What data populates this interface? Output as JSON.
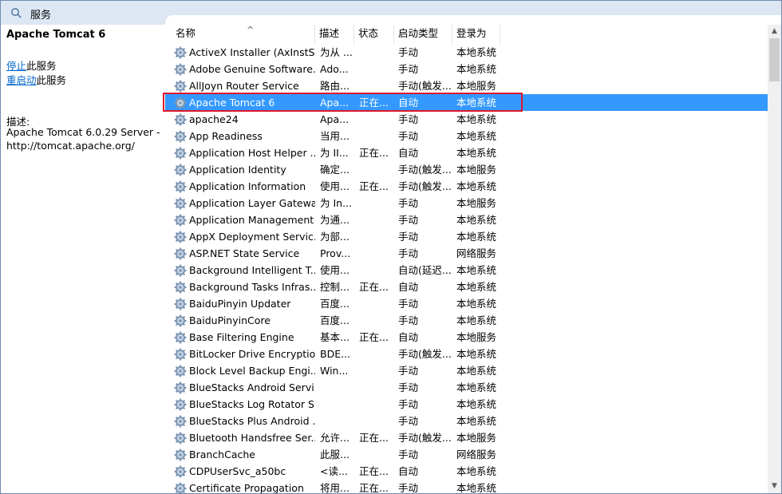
{
  "window": {
    "title": "服务",
    "icon": "services-search-icon"
  },
  "left_panel": {
    "service_name": "Apache Tomcat 6",
    "actions": [
      {
        "link": "停止",
        "suffix": "此服务"
      },
      {
        "link": "重启动",
        "suffix": "此服务"
      }
    ],
    "description_label": "描述:",
    "description_text": "Apache Tomcat 6.0.29 Server - http://tomcat.apache.org/"
  },
  "table": {
    "columns": [
      "名称",
      "描述",
      "状态",
      "启动类型",
      "登录为"
    ],
    "sort_indicator": "^",
    "selected_index": 3,
    "rows": [
      {
        "name": "ActiveX Installer (AxInstSV)",
        "desc": "为从 ...",
        "status": "",
        "startup": "手动",
        "logon": "本地系统"
      },
      {
        "name": "Adobe Genuine Software...",
        "desc": "Ado...",
        "status": "",
        "startup": "手动",
        "logon": "本地系统"
      },
      {
        "name": "AllJoyn Router Service",
        "desc": "路由...",
        "status": "",
        "startup": "手动(触发...",
        "logon": "本地服务"
      },
      {
        "name": "Apache Tomcat 6",
        "desc": "Apa...",
        "status": "正在...",
        "startup": "自动",
        "logon": "本地系统"
      },
      {
        "name": "apache24",
        "desc": "Apa...",
        "status": "",
        "startup": "手动",
        "logon": "本地系统"
      },
      {
        "name": "App Readiness",
        "desc": "当用...",
        "status": "",
        "startup": "手动",
        "logon": "本地系统"
      },
      {
        "name": "Application Host Helper ...",
        "desc": "为 II...",
        "status": "正在...",
        "startup": "自动",
        "logon": "本地系统"
      },
      {
        "name": "Application Identity",
        "desc": "确定...",
        "status": "",
        "startup": "手动(触发...",
        "logon": "本地服务"
      },
      {
        "name": "Application Information",
        "desc": "使用...",
        "status": "正在...",
        "startup": "手动(触发...",
        "logon": "本地系统"
      },
      {
        "name": "Application Layer Gatewa...",
        "desc": "为 In...",
        "status": "",
        "startup": "手动",
        "logon": "本地服务"
      },
      {
        "name": "Application Management",
        "desc": "为通...",
        "status": "",
        "startup": "手动",
        "logon": "本地系统"
      },
      {
        "name": "AppX Deployment Servic...",
        "desc": "为部...",
        "status": "",
        "startup": "手动",
        "logon": "本地系统"
      },
      {
        "name": "ASP.NET State Service",
        "desc": "Prov...",
        "status": "",
        "startup": "手动",
        "logon": "网络服务"
      },
      {
        "name": "Background Intelligent T...",
        "desc": "使用...",
        "status": "",
        "startup": "自动(延迟...",
        "logon": "本地系统"
      },
      {
        "name": "Background Tasks Infras...",
        "desc": "控制...",
        "status": "正在...",
        "startup": "自动",
        "logon": "本地系统"
      },
      {
        "name": "BaiduPinyin Updater",
        "desc": "百度...",
        "status": "",
        "startup": "手动",
        "logon": "本地系统"
      },
      {
        "name": "BaiduPinyinCore",
        "desc": "百度...",
        "status": "",
        "startup": "手动",
        "logon": "本地系统"
      },
      {
        "name": "Base Filtering Engine",
        "desc": "基本...",
        "status": "正在...",
        "startup": "自动",
        "logon": "本地服务"
      },
      {
        "name": "BitLocker Drive Encryptio...",
        "desc": "BDE...",
        "status": "",
        "startup": "手动(触发...",
        "logon": "本地系统"
      },
      {
        "name": "Block Level Backup Engi...",
        "desc": "Win...",
        "status": "",
        "startup": "手动",
        "logon": "本地系统"
      },
      {
        "name": "BlueStacks Android Servi...",
        "desc": "",
        "status": "",
        "startup": "手动",
        "logon": "本地系统"
      },
      {
        "name": "BlueStacks Log Rotator S...",
        "desc": "",
        "status": "",
        "startup": "手动",
        "logon": "本地系统"
      },
      {
        "name": "BlueStacks Plus Android ...",
        "desc": "",
        "status": "",
        "startup": "手动",
        "logon": "本地系统"
      },
      {
        "name": "Bluetooth Handsfree Ser...",
        "desc": "允许...",
        "status": "正在...",
        "startup": "手动(触发...",
        "logon": "本地服务"
      },
      {
        "name": "BranchCache",
        "desc": "此服...",
        "status": "",
        "startup": "手动",
        "logon": "网络服务"
      },
      {
        "name": "CDPUserSvc_a50bc",
        "desc": "<读...",
        "status": "正在...",
        "startup": "自动",
        "logon": "本地系统"
      },
      {
        "name": "Certificate Propagation",
        "desc": "将用...",
        "status": "正在...",
        "startup": "手动",
        "logon": "本地系统"
      }
    ]
  },
  "colors": {
    "selection": "#3399ff",
    "highlight_border": "#e0182c",
    "titlebar": "#dde7f3",
    "link": "#0066cc"
  }
}
